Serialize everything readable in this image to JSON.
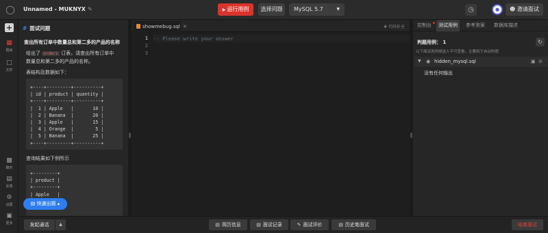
{
  "app": {
    "title": "Unnamed - MUKNYX",
    "edit_icon": "pencil-icon"
  },
  "toolbar": {
    "run_label": "运行用例",
    "select_question_label": "选择问题",
    "db_version": "MySQL 5.7",
    "invite_label": "邀请面试",
    "run_color": "#d9342b"
  },
  "rail": {
    "items": [
      {
        "icon": "add-icon",
        "label": ""
      },
      {
        "icon": "question-icon",
        "label": "题目"
      },
      {
        "icon": "file-icon",
        "label": "文件"
      },
      {
        "icon": "chat-icon",
        "label": "聊天"
      },
      {
        "icon": "note-icon",
        "label": "反馈"
      },
      {
        "icon": "gear-icon",
        "label": "设置"
      },
      {
        "icon": "more-icon",
        "label": "更多"
      }
    ]
  },
  "problem": {
    "header": "面试问题",
    "title": "查出所有订单中数量总和第二多的产品的名称",
    "desc_prefix": "给出了",
    "desc_code": "orders",
    "desc_suffix": "订表，请查出所有订单中",
    "desc_line2": "数量总和第二多的产品的名称。",
    "table_caption": "表结构及数据如下：",
    "table_text": "+----+---------+----------+\n| id | product | quantity |\n+----+---------+----------+\n|  1 | Apple   |       10 |\n|  2 | Banana  |       20 |\n|  3 | Apple   |       15 |\n|  4 | Orange  |        5 |\n|  5 | Banana  |       25 |\n+----+---------+----------+",
    "result_caption": "查询结果如下例所示",
    "result_text": "+---------+\n| product |\n+---------+\n| Apple   |",
    "quick_button": "快速出题"
  },
  "editor": {
    "tab_name": "showmebug.sql",
    "completion_label": "代码补全",
    "line_numbers": [
      "1",
      "2",
      "3"
    ],
    "placeholder": "-- Please write your answer"
  },
  "right": {
    "tabs": [
      "控制台",
      "测试用例",
      "参考答案",
      "数据库描述"
    ],
    "cases_title": "判题用例： 1",
    "cases_note": "以下面试用例候选人不可查看，主要用于自动判题",
    "hidden_file": "hidden_mysql.sql",
    "no_output": "没有任何输出"
  },
  "bottom": {
    "call_label": "发起通话",
    "buttons": [
      "简历信息",
      "面试记录",
      "面试评价",
      "历史笔面试"
    ],
    "end_label": "结束面试",
    "end_color": "#e0413a"
  }
}
